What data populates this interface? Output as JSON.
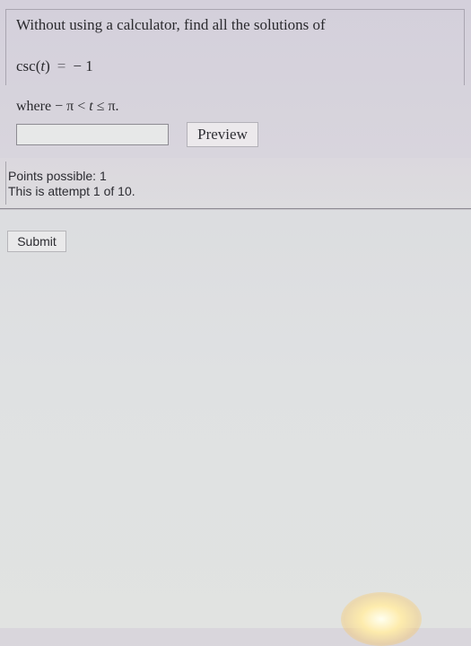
{
  "question": {
    "prompt": "Without using a calculator, find all the solutions of",
    "equation": {
      "func": "csc(",
      "var": "t",
      "close": ")",
      "rel": "=",
      "value": "− 1"
    },
    "domain": {
      "word": "where",
      "left": "− π",
      "lt": "<",
      "var": "t",
      "le": "≤",
      "right": "π."
    },
    "answer_value": "",
    "preview_label": "Preview"
  },
  "info": {
    "points_text": "Points possible: 1",
    "attempt_text": "This is attempt 1 of 10."
  },
  "actions": {
    "submit_label": "Submit"
  }
}
